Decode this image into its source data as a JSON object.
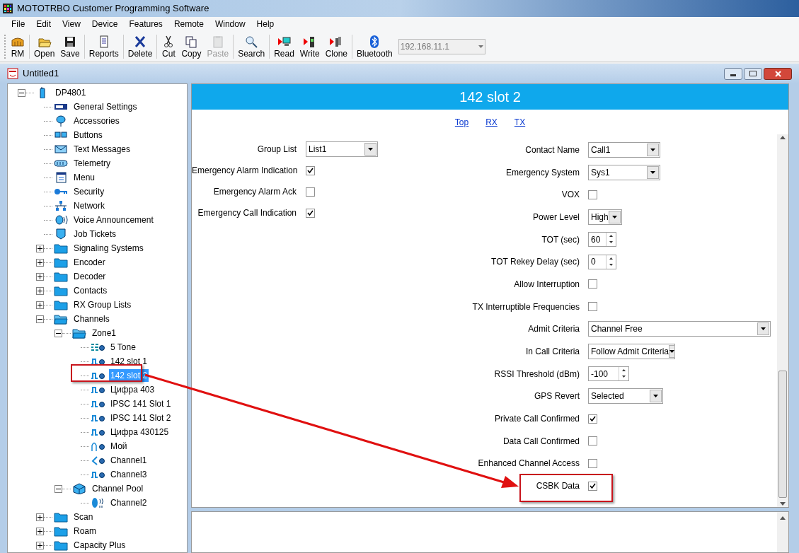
{
  "window": {
    "title": "MOTOTRBO Customer Programming Software"
  },
  "menu": [
    "File",
    "Edit",
    "View",
    "Device",
    "Features",
    "Remote",
    "Window",
    "Help"
  ],
  "toolbar": {
    "groups": [
      [
        {
          "label": "RM",
          "kind": "rm",
          "disabled": false
        }
      ],
      [
        {
          "label": "Open",
          "kind": "open",
          "disabled": false
        },
        {
          "label": "Save",
          "kind": "save",
          "disabled": false
        }
      ],
      [
        {
          "label": "Reports",
          "kind": "report",
          "disabled": false
        }
      ],
      [
        {
          "label": "Delete",
          "kind": "delete",
          "disabled": false
        }
      ],
      [
        {
          "label": "Cut",
          "kind": "cut",
          "disabled": false
        },
        {
          "label": "Copy",
          "kind": "copy",
          "disabled": false
        },
        {
          "label": "Paste",
          "kind": "paste",
          "disabled": true
        }
      ],
      [
        {
          "label": "Search",
          "kind": "search",
          "disabled": false
        }
      ],
      [
        {
          "label": "Read",
          "kind": "read",
          "disabled": false
        },
        {
          "label": "Write",
          "kind": "write",
          "disabled": false
        },
        {
          "label": "Clone",
          "kind": "clone",
          "disabled": false
        }
      ],
      [
        {
          "label": "Bluetooth",
          "kind": "bluetooth",
          "disabled": false
        }
      ]
    ],
    "address": {
      "value": "192.168.11.1"
    }
  },
  "document": {
    "title": "Untitled1"
  },
  "tree": [
    {
      "label": "DP4801",
      "kind": "device",
      "expanded": true,
      "selected": false,
      "children": [
        {
          "label": "General Settings",
          "kind": "set",
          "selected": false
        },
        {
          "label": "Accessories",
          "kind": "accessory",
          "selected": false
        },
        {
          "label": "Buttons",
          "kind": "buttons",
          "selected": false
        },
        {
          "label": "Text Messages",
          "kind": "mail",
          "selected": false
        },
        {
          "label": "Telemetry",
          "kind": "telemetry",
          "selected": false
        },
        {
          "label": "Menu",
          "kind": "menu",
          "selected": false
        },
        {
          "label": "Security",
          "kind": "key",
          "selected": false
        },
        {
          "label": "Network",
          "kind": "network",
          "selected": false
        },
        {
          "label": "Voice Announcement",
          "kind": "voice",
          "selected": false
        },
        {
          "label": "Job Tickets",
          "kind": "ticket",
          "selected": false
        },
        {
          "label": "Signaling Systems",
          "kind": "folder",
          "expanded": false,
          "selected": false
        },
        {
          "label": "Encoder",
          "kind": "folder",
          "expanded": false,
          "selected": false
        },
        {
          "label": "Decoder",
          "kind": "folder",
          "expanded": false,
          "selected": false
        },
        {
          "label": "Contacts",
          "kind": "folder",
          "expanded": false,
          "selected": false
        },
        {
          "label": "RX Group Lists",
          "kind": "folder",
          "expanded": false,
          "selected": false
        },
        {
          "label": "Channels",
          "kind": "folder-open",
          "expanded": true,
          "selected": false,
          "children": [
            {
              "label": "Zone1",
              "kind": "folder-open",
              "expanded": true,
              "selected": false,
              "children": [
                {
                  "label": "5 Tone",
                  "kind": "tone",
                  "selected": false
                },
                {
                  "label": "142 slot 1",
                  "kind": "digital",
                  "selected": false
                },
                {
                  "label": "142 slot 2",
                  "kind": "digital",
                  "selected": true
                },
                {
                  "label": "Цифра 403",
                  "kind": "digital",
                  "selected": false
                },
                {
                  "label": "IPSC 141 Slot 1",
                  "kind": "digital",
                  "selected": false
                },
                {
                  "label": "IPSC 141 Slot 2",
                  "kind": "digital",
                  "selected": false
                },
                {
                  "label": "Цифра 430125",
                  "kind": "digital",
                  "selected": false
                },
                {
                  "label": "Мой",
                  "kind": "analog",
                  "selected": false
                },
                {
                  "label": "Channel1",
                  "kind": "capacity",
                  "selected": false
                },
                {
                  "label": "Channel3",
                  "kind": "digital",
                  "selected": false
                }
              ]
            },
            {
              "label": "Channel Pool",
              "kind": "pool",
              "expanded": true,
              "selected": false,
              "children": [
                {
                  "label": "Channel2",
                  "kind": "pool-channel",
                  "selected": false
                }
              ]
            }
          ]
        },
        {
          "label": "Scan",
          "kind": "folder",
          "expanded": false,
          "selected": false
        },
        {
          "label": "Roam",
          "kind": "folder",
          "expanded": false,
          "selected": false
        },
        {
          "label": "Capacity Plus",
          "kind": "folder",
          "expanded": false,
          "selected": false
        }
      ]
    }
  ],
  "panel": {
    "heading": "142 slot 2",
    "links": [
      "Top",
      "RX",
      "TX"
    ],
    "left_fields": [
      {
        "label": "Group List",
        "kind": "dropdown",
        "value": "List1"
      },
      {
        "label": "Emergency Alarm Indication",
        "kind": "checkbox",
        "checked": true
      },
      {
        "label": "Emergency Alarm Ack",
        "kind": "checkbox",
        "checked": false
      },
      {
        "label": "Emergency Call Indication",
        "kind": "checkbox",
        "checked": true
      }
    ],
    "right_fields": [
      {
        "label": "Contact Name",
        "kind": "dropdown",
        "value": "Call1"
      },
      {
        "label": "Emergency System",
        "kind": "dropdown",
        "value": "Sys1"
      },
      {
        "label": "VOX",
        "kind": "checkbox",
        "checked": false
      },
      {
        "label": "Power Level",
        "kind": "dropdown",
        "value": "High"
      },
      {
        "label": "TOT (sec)",
        "kind": "spinner",
        "value": "60"
      },
      {
        "label": "TOT Rekey Delay (sec)",
        "kind": "spinner",
        "value": "0"
      },
      {
        "label": "Allow Interruption",
        "kind": "checkbox",
        "checked": false
      },
      {
        "label": "TX Interruptible Frequencies",
        "kind": "checkbox",
        "checked": false
      },
      {
        "label": "Admit Criteria",
        "kind": "dropdown",
        "value": "Channel Free"
      },
      {
        "label": "In Call Criteria",
        "kind": "dropdown",
        "value": "Follow Admit Criteria"
      },
      {
        "label": "RSSI Threshold (dBm)",
        "kind": "spinner",
        "value": "-100"
      },
      {
        "label": "GPS Revert",
        "kind": "dropdown",
        "value": "Selected"
      },
      {
        "label": "Private Call Confirmed",
        "kind": "checkbox",
        "checked": true
      },
      {
        "label": "Data Call Confirmed",
        "kind": "checkbox",
        "checked": false
      },
      {
        "label": "Enhanced Channel Access",
        "kind": "checkbox",
        "checked": false
      },
      {
        "label": "CSBK Data",
        "kind": "checkbox",
        "checked": true
      }
    ]
  }
}
